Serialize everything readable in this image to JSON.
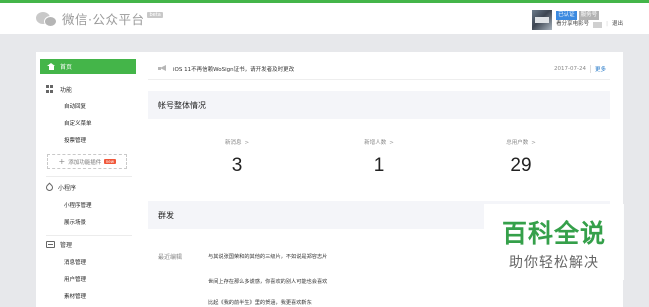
{
  "header": {
    "app_title": "微信·公众平台",
    "beta_tag": "beta",
    "user": {
      "badge_verified": "已认证",
      "badge_type": "服务号",
      "account_name": "看分享电影号",
      "logout_label": "退出"
    }
  },
  "sidebar": {
    "home_label": "首页",
    "sections": [
      {
        "title": "功能",
        "icon": "grid-icon",
        "items": [
          "自动回复",
          "自定义菜单",
          "投票管理"
        ]
      },
      {
        "title": "小程序",
        "icon": "link-icon",
        "items": [
          "小程序管理",
          "展示场景"
        ]
      },
      {
        "title": "管理",
        "icon": "box-icon",
        "items": [
          "消息管理",
          "用户管理",
          "素材管理"
        ]
      }
    ],
    "add_plugin_label": "添加功能插件",
    "new_tag": "new"
  },
  "notice": {
    "text": "iOS 11不再信赖WoSign证书，请开发者及时更改",
    "date": "2017-07-24",
    "more_label": "更多"
  },
  "account_overview": {
    "title": "帐号整体情况",
    "stats": [
      {
        "label": "新消息",
        "value": "3"
      },
      {
        "label": "新增人数",
        "value": "1"
      },
      {
        "label": "总用户数",
        "value": "29"
      }
    ]
  },
  "broadcast": {
    "title": "群发",
    "recent_label": "最近编辑",
    "messages": [
      "与其说张国荣和的其他的三级片，不如说是郑容志片",
      "世间上存在那么多谎感，你喜欢的别人可能也会喜欢",
      "比起《我的前半生》里的贺涵，我更喜欢靳东"
    ]
  },
  "watermark": {
    "title": "百科全说",
    "subtitle": "助你轻松解决"
  },
  "colors": {
    "accent": "#44b549",
    "link": "#1e74c6",
    "watermark": "#35a04a"
  }
}
